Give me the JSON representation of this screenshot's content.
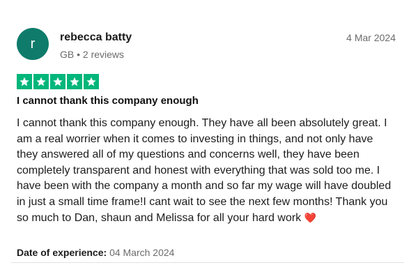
{
  "colors": {
    "avatar_bg": "#0e7b6b",
    "star_bg": "#00b67a",
    "star_fill": "#ffffff"
  },
  "review": {
    "avatar_initial": "r",
    "author": "rebecca batty",
    "meta": "GB • 2 reviews",
    "date": "4 Mar 2024",
    "rating": 5,
    "rating_max": 5,
    "title": "I cannot thank this company enough",
    "body": "I cannot thank this company enough. They have all been absolutely great. I am a real worrier when it comes to investing in things, and not only have they answered all of my questions and concerns well, they have been completely transparent and honest with everything that was sold too me. I have been with the company a month and so far my wage will have doubled in just a small time frame!I cant wait to see the next few months! Thank you so much to Dan, shaun and Melissa for all your hard work",
    "body_emoji": "❤️",
    "experience_label": "Date of experience:",
    "experience_date": "04 March 2024"
  },
  "icons": {
    "star": "star-icon",
    "heart": "heart-icon"
  }
}
